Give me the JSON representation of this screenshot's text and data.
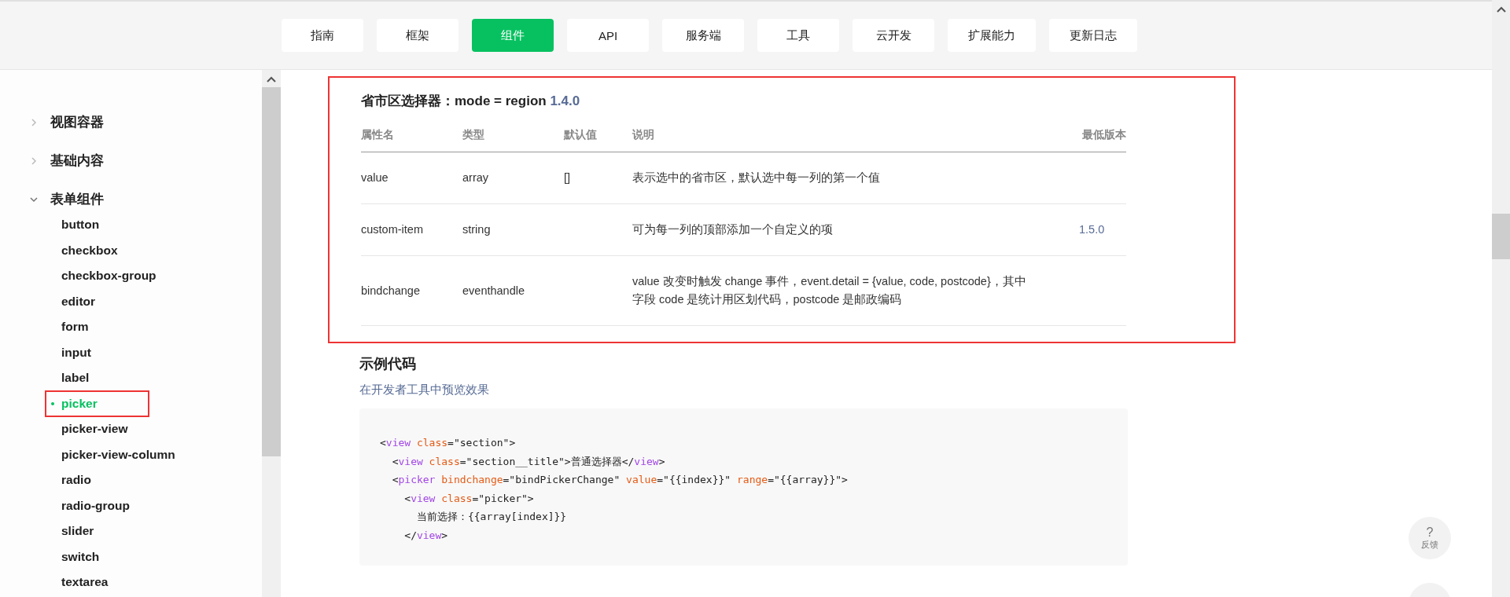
{
  "nav": {
    "tabs": [
      {
        "label": "指南",
        "selected": false
      },
      {
        "label": "框架",
        "selected": false
      },
      {
        "label": "组件",
        "selected": true
      },
      {
        "label": "API",
        "selected": false
      },
      {
        "label": "服务端",
        "selected": false
      },
      {
        "label": "工具",
        "selected": false
      },
      {
        "label": "云开发",
        "selected": false
      },
      {
        "label": "扩展能力",
        "selected": false
      },
      {
        "label": "更新日志",
        "selected": false
      }
    ]
  },
  "sidebar": {
    "groups": [
      {
        "label": "视图容器",
        "expanded": false
      },
      {
        "label": "基础内容",
        "expanded": false
      },
      {
        "label": "表单组件",
        "expanded": true,
        "children": [
          {
            "label": "button",
            "selected": false,
            "highlighted": false
          },
          {
            "label": "checkbox",
            "selected": false,
            "highlighted": false
          },
          {
            "label": "checkbox-group",
            "selected": false,
            "highlighted": false
          },
          {
            "label": "editor",
            "selected": false,
            "highlighted": false
          },
          {
            "label": "form",
            "selected": false,
            "highlighted": false
          },
          {
            "label": "input",
            "selected": false,
            "highlighted": false
          },
          {
            "label": "label",
            "selected": false,
            "highlighted": false
          },
          {
            "label": "picker",
            "selected": true,
            "highlighted": true
          },
          {
            "label": "picker-view",
            "selected": false,
            "highlighted": false
          },
          {
            "label": "picker-view-column",
            "selected": false,
            "highlighted": false
          },
          {
            "label": "radio",
            "selected": false,
            "highlighted": false
          },
          {
            "label": "radio-group",
            "selected": false,
            "highlighted": false
          },
          {
            "label": "slider",
            "selected": false,
            "highlighted": false
          },
          {
            "label": "switch",
            "selected": false,
            "highlighted": false
          },
          {
            "label": "textarea",
            "selected": false,
            "highlighted": false
          }
        ]
      }
    ]
  },
  "section": {
    "title": "省市区选择器：mode = region",
    "version": "1.4.0",
    "highlighted": true,
    "table": {
      "columns": [
        "属性名",
        "类型",
        "默认值",
        "说明",
        "最低版本"
      ],
      "rows": [
        [
          "value",
          "array",
          "[]",
          "表示选中的省市区，默认选中每一列的第一个值",
          ""
        ],
        [
          "custom-item",
          "string",
          "",
          "可为每一列的顶部添加一个自定义的项",
          "1.5.0"
        ],
        [
          "bindchange",
          "eventhandle",
          "",
          "value 改变时触发 change 事件，event.detail = {value, code, postcode}，其中字段 code 是统计用区划代码，postcode 是邮政编码",
          ""
        ]
      ]
    }
  },
  "example": {
    "heading": "示例代码",
    "link": "在开发者工具中预览效果",
    "code": [
      [
        {
          "kind": "punct",
          "text": "<"
        },
        {
          "kind": "tag",
          "text": "view"
        },
        {
          "kind": "attr",
          "text": " class"
        },
        {
          "kind": "punct",
          "text": "=\"section\">"
        }
      ],
      [
        {
          "kind": "punct",
          "text": "  <"
        },
        {
          "kind": "tag",
          "text": "view"
        },
        {
          "kind": "attr",
          "text": " class"
        },
        {
          "kind": "punct",
          "text": "=\"section__title\">普通选择器</"
        },
        {
          "kind": "tag",
          "text": "view"
        },
        {
          "kind": "punct",
          "text": ">"
        }
      ],
      [
        {
          "kind": "punct",
          "text": "  <"
        },
        {
          "kind": "tag",
          "text": "picker"
        },
        {
          "kind": "attr",
          "text": " bindchange"
        },
        {
          "kind": "punct",
          "text": "=\"bindPickerChange\""
        },
        {
          "kind": "attr",
          "text": " value"
        },
        {
          "kind": "punct",
          "text": "=\"{{index}}\""
        },
        {
          "kind": "attr",
          "text": " range"
        },
        {
          "kind": "punct",
          "text": "=\"{{array}}\">"
        }
      ],
      [
        {
          "kind": "punct",
          "text": "    <"
        },
        {
          "kind": "tag",
          "text": "view"
        },
        {
          "kind": "attr",
          "text": " class"
        },
        {
          "kind": "punct",
          "text": "=\"picker\">"
        }
      ],
      [
        {
          "kind": "punct",
          "text": "      当前选择：{{array[index]}}"
        }
      ],
      [
        {
          "kind": "punct",
          "text": "    </"
        },
        {
          "kind": "tag",
          "text": "view"
        },
        {
          "kind": "punct",
          "text": ">"
        }
      ]
    ]
  },
  "feedback": {
    "icon": "?",
    "label": "反馈"
  }
}
